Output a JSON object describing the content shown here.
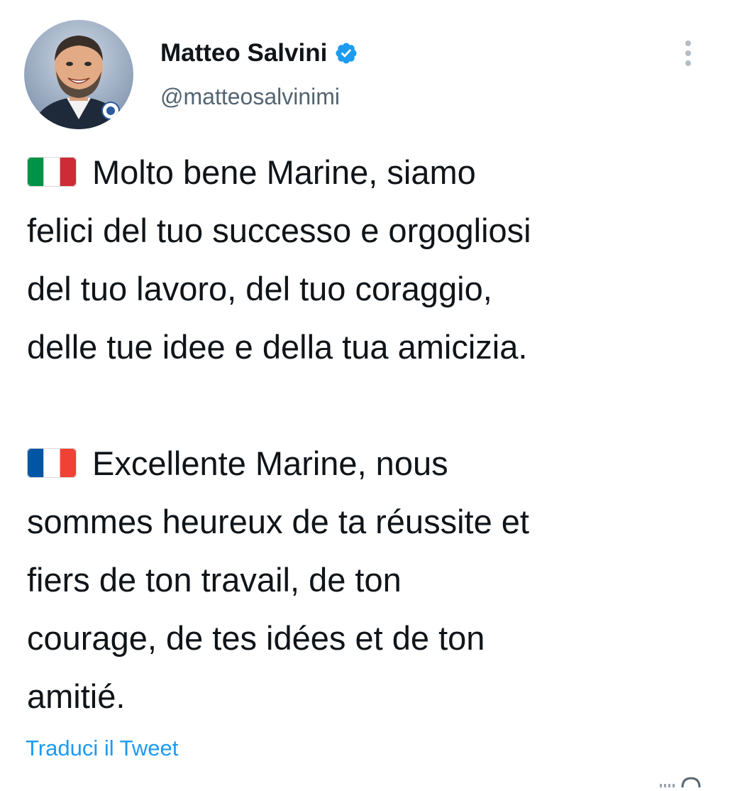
{
  "author": {
    "display_name": "Matteo Salvini",
    "handle": "@matteosalvinimi",
    "verified": true,
    "avatar_icon": "profile-photo-avatar"
  },
  "tweet": {
    "paragraphs": [
      {
        "flag_icon": "italy-flag-icon",
        "lines": [
          "Molto bene Marine, siamo",
          "felici del tuo successo e orgogliosi",
          "del tuo lavoro, del tuo coraggio,",
          "delle tue idee e della tua amicizia."
        ]
      },
      {
        "flag_icon": "france-flag-icon",
        "lines": [
          "Excellente Marine, nous",
          "sommes heureux de ta réussite et",
          "fiers de ton travail, de ton",
          "courage, de tes idées et de ton",
          "amitié."
        ]
      }
    ],
    "translate_label": "Traduci il Tweet"
  },
  "icons": {
    "more": "more-options-icon",
    "verified": "verified-badge-icon"
  },
  "colors": {
    "text": "#0f1419",
    "secondary_text": "#536471",
    "link": "#1d9bf0",
    "verified_badge": "#1d9bf0",
    "italy_green": "#009246",
    "italy_white": "#ffffff",
    "italy_red": "#ce2b37",
    "france_blue": "#0055a4",
    "france_white": "#ffffff",
    "france_red": "#ef4135"
  }
}
